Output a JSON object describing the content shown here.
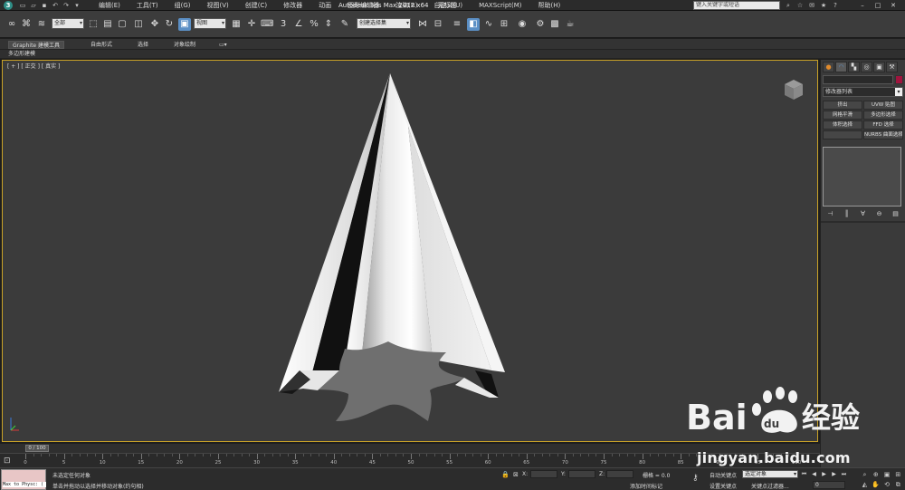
{
  "titlebar": {
    "app_name": "Autodesk 3ds Max  2012 x64",
    "doc_name": "无标题",
    "search_placeholder": "键入关键字或短语",
    "menu": [
      "编辑(E)",
      "工具(T)",
      "组(G)",
      "视图(V)",
      "创建(C)",
      "修改器",
      "动画",
      "图形编辑器",
      "渲染(R)",
      "自定义(U)",
      "MAXScript(M)",
      "帮助(H)"
    ]
  },
  "toolbar": {
    "filter_select": "全部",
    "coord_select": "视图",
    "named_selection": "创建选择集"
  },
  "ribbon": {
    "tabs": [
      "Graphite 建模工具",
      "自由形式",
      "选择",
      "对象绘制"
    ],
    "active_tab": "Graphite 建模工具",
    "sub_label": "多边形建模"
  },
  "viewport": {
    "label": "[ + ] [ 正交 ] [ 真实 ]",
    "border_color": "#c9a227"
  },
  "command_panel": {
    "modifier_list": "修改器列表",
    "buttons": [
      "挤出",
      "UVW 贴图",
      "网格平滑",
      "多边形选择",
      "体积选择",
      "FFD 选择",
      "",
      "NURBS 曲面选择"
    ]
  },
  "timeline": {
    "thumb": "0 / 100",
    "ticks": [
      0,
      5,
      10,
      15,
      20,
      25,
      30,
      35,
      40,
      45,
      50,
      55,
      60,
      65,
      70,
      75,
      80,
      85,
      90,
      95,
      100
    ]
  },
  "status": {
    "maxscript": "Max to Physc: (",
    "line1": "未选定任何对象",
    "line2": "单击并拖动以选择并移动对象(约句相)",
    "x_label": "X:",
    "y_label": "Y:",
    "z_label": "Z:",
    "grid": "栅格 = 0.0",
    "add_tag": "添加时间标记",
    "auto_key": "自动关键点",
    "set_key": "设置关键点",
    "selection": "选定对象",
    "key_filter": "关键点过滤器...",
    "frame": "0"
  },
  "watermark": {
    "url": "jingyan.baidu.com",
    "brand": "Bai",
    "brand_du": "du",
    "brand_cn": "经验"
  },
  "colors": {
    "accent": "#5b8fc5",
    "object_color": "#a0153e"
  }
}
